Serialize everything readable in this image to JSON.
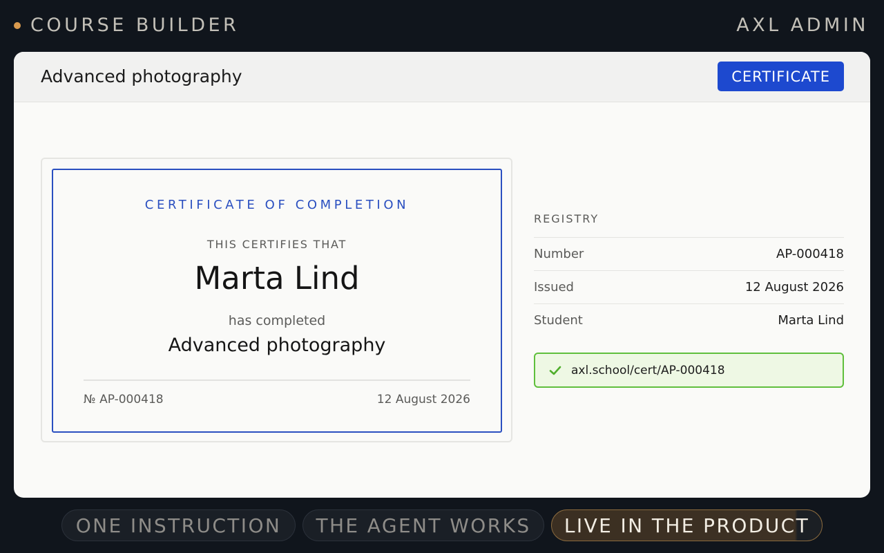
{
  "topbar": {
    "brand": "COURSE BUILDER",
    "admin": "AXL ADMIN"
  },
  "window": {
    "title": "Advanced photography",
    "certificate_button": "CERTIFICATE"
  },
  "certificate": {
    "heading": "CERTIFICATE OF COMPLETION",
    "certifies": "THIS CERTIFIES THAT",
    "name": "Marta Lind",
    "completed": "has completed",
    "course": "Advanced photography",
    "number": "№ AP-000418",
    "date": "12 August 2026"
  },
  "registry": {
    "title": "REGISTRY",
    "rows": [
      {
        "label": "Number",
        "value": "AP-000418"
      },
      {
        "label": "Issued",
        "value": "12 August 2026"
      },
      {
        "label": "Student",
        "value": "Marta Lind"
      }
    ],
    "link": "axl.school/cert/AP-000418"
  },
  "steps": [
    {
      "label": "ONE INSTRUCTION"
    },
    {
      "label": "THE AGENT WORKS"
    },
    {
      "label": "LIVE IN THE PRODUCT"
    }
  ],
  "colors": {
    "accent_blue": "#1d49cf",
    "success_green": "#5fbf3c",
    "brand_dot": "#d99a4e"
  }
}
